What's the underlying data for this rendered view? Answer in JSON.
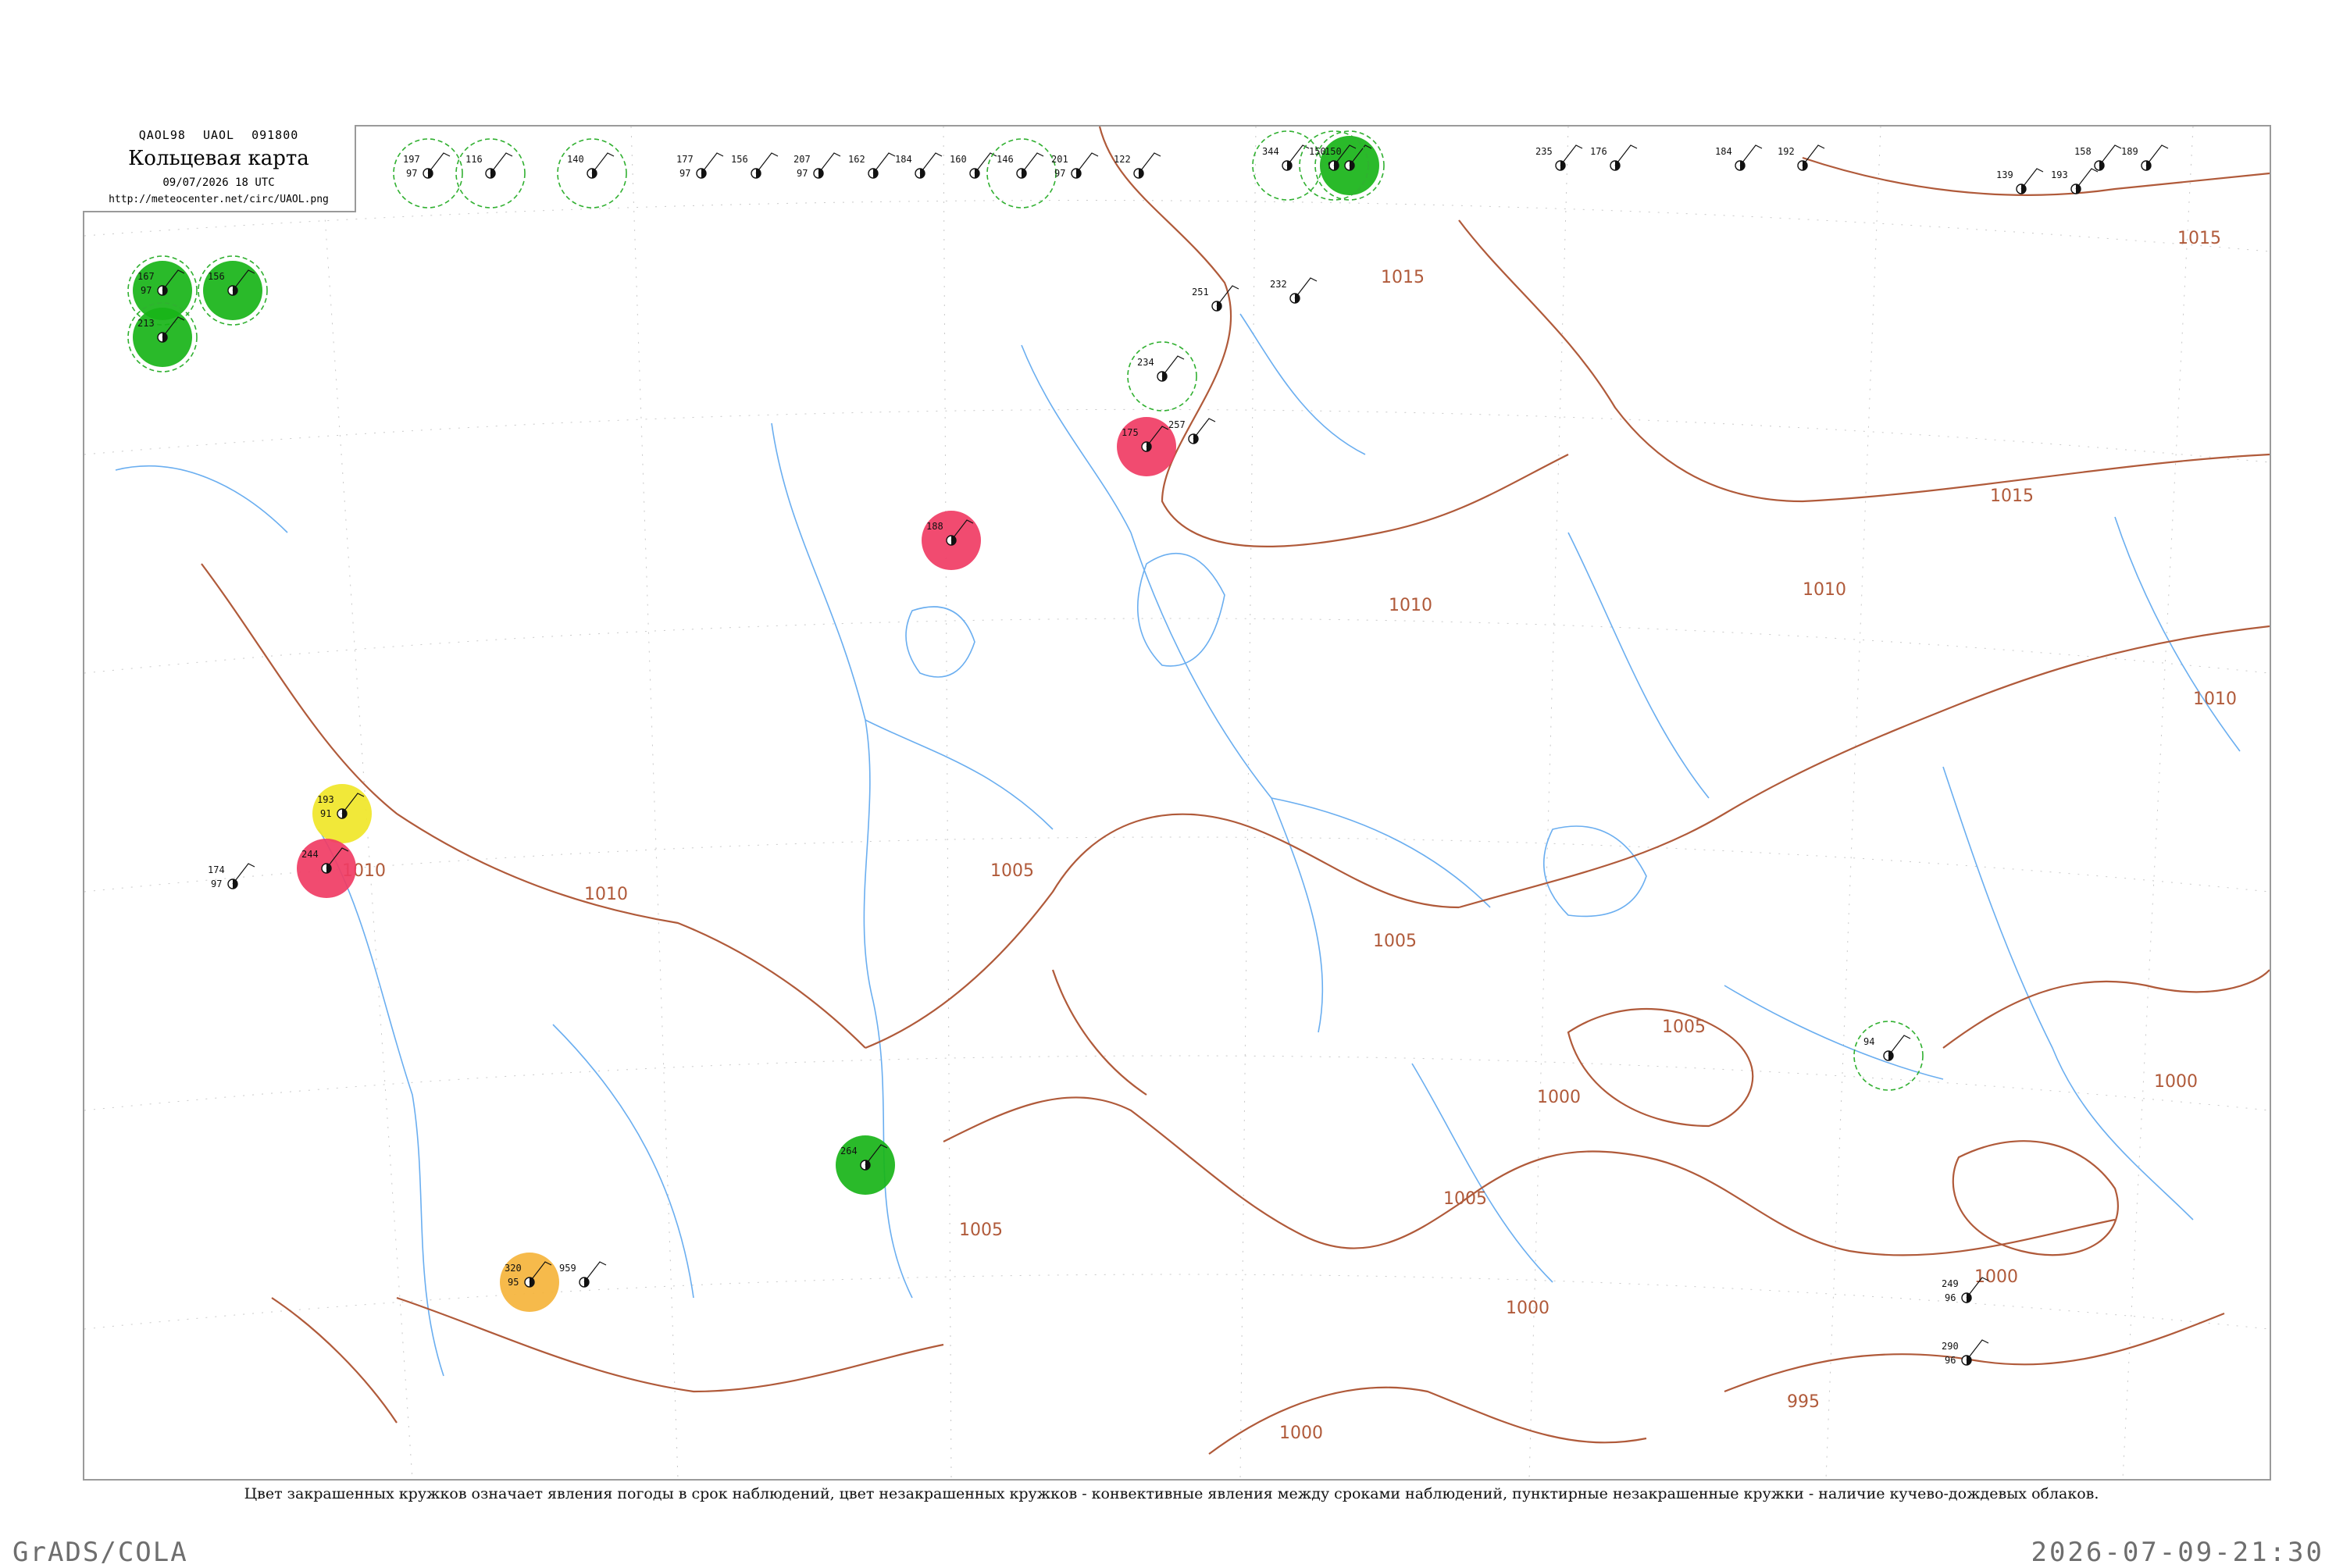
{
  "header": {
    "codes": [
      "QAOL98",
      "UAOL",
      "091800"
    ],
    "title": "Кольцевая карта",
    "datetime": "09/07/2026 18 UTC",
    "url": "http://meteocenter.net/circ/UAOL.png"
  },
  "caption": "Цвет закрашенных кружков означает явления погоды в срок наблюдений, цвет незакрашенных кружков - конвективные явления между сроками наблюдений, пунктирные незакрашенные кружки - наличие кучево-дождевых облаков.",
  "footer": {
    "left": "GrADS/COLA",
    "right": "2026-07-09-21:30"
  },
  "colors": {
    "isobar": "#b05a3a",
    "river": "#6aaef0",
    "rain_fill": "#18b418",
    "thunder_fill": "#f03c64",
    "fog_fill": "#f0e628",
    "dust_fill": "#f5b43c",
    "cb_ring": "#30b030",
    "convective_ring": "#e0506e"
  },
  "isobar_labels": [
    "1015",
    "1015",
    "1010",
    "1010",
    "1010",
    "1010",
    "1010",
    "1005",
    "1005",
    "1005",
    "1005",
    "1005",
    "1000",
    "1000",
    "1000",
    "1000",
    "1000",
    "995",
    "1015"
  ],
  "stations": [
    {
      "p": "197",
      "t": "97",
      "d": "",
      "name": "",
      "cb": true,
      "fill": ""
    },
    {
      "p": "116",
      "t": "",
      "d": "",
      "name": "",
      "cb": true,
      "fill": ""
    },
    {
      "p": "150",
      "t": "97",
      "d": "",
      "name": "",
      "cb": true,
      "fill": "rain"
    },
    {
      "p": "140",
      "t": "",
      "d": "",
      "name": "",
      "cb": true,
      "fill": ""
    },
    {
      "p": "177",
      "t": "97",
      "d": "",
      "name": "",
      "cb": false,
      "fill": ""
    },
    {
      "p": "156",
      "t": "",
      "d": "",
      "name": "",
      "cb": false,
      "fill": ""
    },
    {
      "p": "207",
      "t": "97",
      "d": "",
      "name": "",
      "cb": false,
      "fill": ""
    },
    {
      "p": "162",
      "t": "",
      "d": "",
      "name": "",
      "cb": false,
      "fill": ""
    },
    {
      "p": "184",
      "t": "",
      "d": "",
      "name": "",
      "cb": false,
      "fill": ""
    },
    {
      "p": "160",
      "t": "",
      "d": "",
      "name": "",
      "cb": false,
      "fill": ""
    },
    {
      "p": "146",
      "t": "",
      "d": "",
      "name": "",
      "cb": true,
      "fill": ""
    },
    {
      "p": "201",
      "t": "97",
      "d": "",
      "name": "",
      "cb": false,
      "fill": ""
    },
    {
      "p": "122",
      "t": "",
      "d": "",
      "name": "",
      "cb": false,
      "fill": ""
    },
    {
      "p": "344",
      "t": "",
      "d": "",
      "name": "",
      "cb": true,
      "fill": ""
    },
    {
      "p": "150",
      "t": "",
      "d": "",
      "name": "",
      "cb": true,
      "fill": ""
    },
    {
      "p": "235",
      "t": "",
      "d": "",
      "name": "",
      "cb": false,
      "fill": ""
    },
    {
      "p": "176",
      "t": "",
      "d": "",
      "name": "",
      "cb": false,
      "fill": ""
    },
    {
      "p": "184",
      "t": "",
      "d": "",
      "name": "",
      "cb": false,
      "fill": ""
    },
    {
      "p": "192",
      "t": "",
      "d": "",
      "name": "",
      "cb": false,
      "fill": ""
    },
    {
      "p": "158",
      "t": "",
      "d": "",
      "name": "",
      "cb": false,
      "fill": ""
    },
    {
      "p": "189",
      "t": "",
      "d": "",
      "name": "",
      "cb": false,
      "fill": ""
    },
    {
      "p": "139",
      "t": "",
      "d": "",
      "name": "",
      "cb": false,
      "fill": ""
    },
    {
      "p": "193",
      "t": "",
      "d": "",
      "name": "",
      "cb": false,
      "fill": ""
    },
    {
      "p": "167",
      "t": "97",
      "d": "",
      "name": "",
      "cb": true,
      "fill": "rain"
    },
    {
      "p": "156",
      "t": "",
      "d": "",
      "name": "",
      "cb": true,
      "fill": "rain"
    },
    {
      "p": "213",
      "t": "",
      "d": "",
      "name": "",
      "cb": true,
      "fill": "rain"
    },
    {
      "p": "175",
      "t": "",
      "d": "",
      "name": "",
      "cb": false,
      "fill": "thunder"
    },
    {
      "p": "188",
      "t": "",
      "d": "",
      "name": "",
      "cb": false,
      "fill": "thunder"
    },
    {
      "p": "193",
      "t": "91",
      "d": "",
      "name": "",
      "cb": false,
      "fill": "fog"
    },
    {
      "p": "244",
      "t": "",
      "d": "",
      "name": "",
      "cb": false,
      "fill": "thunder"
    },
    {
      "p": "174",
      "t": "97",
      "d": "",
      "name": "",
      "cb": false,
      "fill": ""
    },
    {
      "p": "264",
      "t": "",
      "d": "",
      "name": "",
      "cb": false,
      "fill": "rain"
    },
    {
      "p": "320",
      "t": "95",
      "d": "",
      "name": "",
      "cb": false,
      "fill": "dust"
    },
    {
      "p": "959",
      "t": "",
      "d": "",
      "name": "",
      "cb": false,
      "fill": ""
    },
    {
      "p": "232",
      "t": "",
      "d": "",
      "name": "",
      "cb": false,
      "fill": ""
    },
    {
      "p": "94",
      "t": "",
      "d": "",
      "name": "",
      "cb": true,
      "fill": ""
    },
    {
      "p": "251",
      "t": "",
      "d": "",
      "name": "",
      "cb": false,
      "fill": ""
    },
    {
      "p": "234",
      "t": "",
      "d": "",
      "name": "",
      "cb": true,
      "fill": ""
    },
    {
      "p": "257",
      "t": "",
      "d": "",
      "name": "",
      "cb": false,
      "fill": ""
    },
    {
      "p": "249",
      "t": "96",
      "d": "",
      "name": "",
      "cb": false,
      "fill": ""
    },
    {
      "p": "290",
      "t": "96",
      "d": "",
      "name": "",
      "cb": false,
      "fill": ""
    }
  ]
}
